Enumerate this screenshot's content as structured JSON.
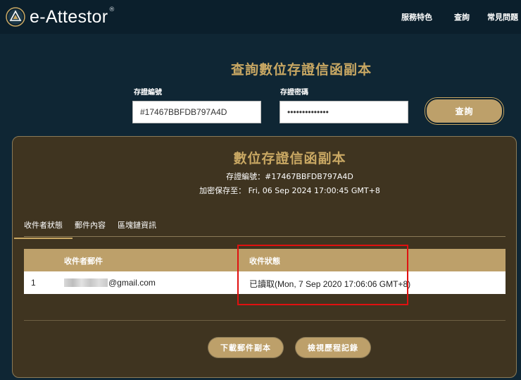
{
  "header": {
    "logo_text": "e-Attestor",
    "logo_mark": "®",
    "nav": [
      "服務特色",
      "查詢",
      "常見問題"
    ]
  },
  "query": {
    "title": "查詢數位存證信函副本",
    "id_label": "存證編號",
    "id_value": "#17467BBFDB797A4D",
    "password_label": "存證密碼",
    "password_value": "••••••••••••••",
    "button": "查詢"
  },
  "certificate": {
    "title": "數位存證信函副本",
    "id_line": "存證編號：#17467BBFDB797A4D",
    "expiry_line": "加密保存至： Fri, 06 Sep 2024 17:00:45 GMT+8"
  },
  "tabs": [
    "收件者狀態",
    "郵件內容",
    "區塊鏈資訊"
  ],
  "table": {
    "headers": [
      "收件者郵件",
      "收件狀態"
    ],
    "rows": [
      {
        "num": "1",
        "email": "@gmail.com",
        "status": "已讀取(Mon, 7 Sep 2020 17:06:06 GMT+8)"
      }
    ]
  },
  "actions": {
    "download": "下載郵件副本",
    "history": "檢視歷程記錄"
  },
  "colors": {
    "background": "#0f2634",
    "gold": "#c9a863",
    "panel": "#3f3420",
    "highlight": "#e01010"
  }
}
